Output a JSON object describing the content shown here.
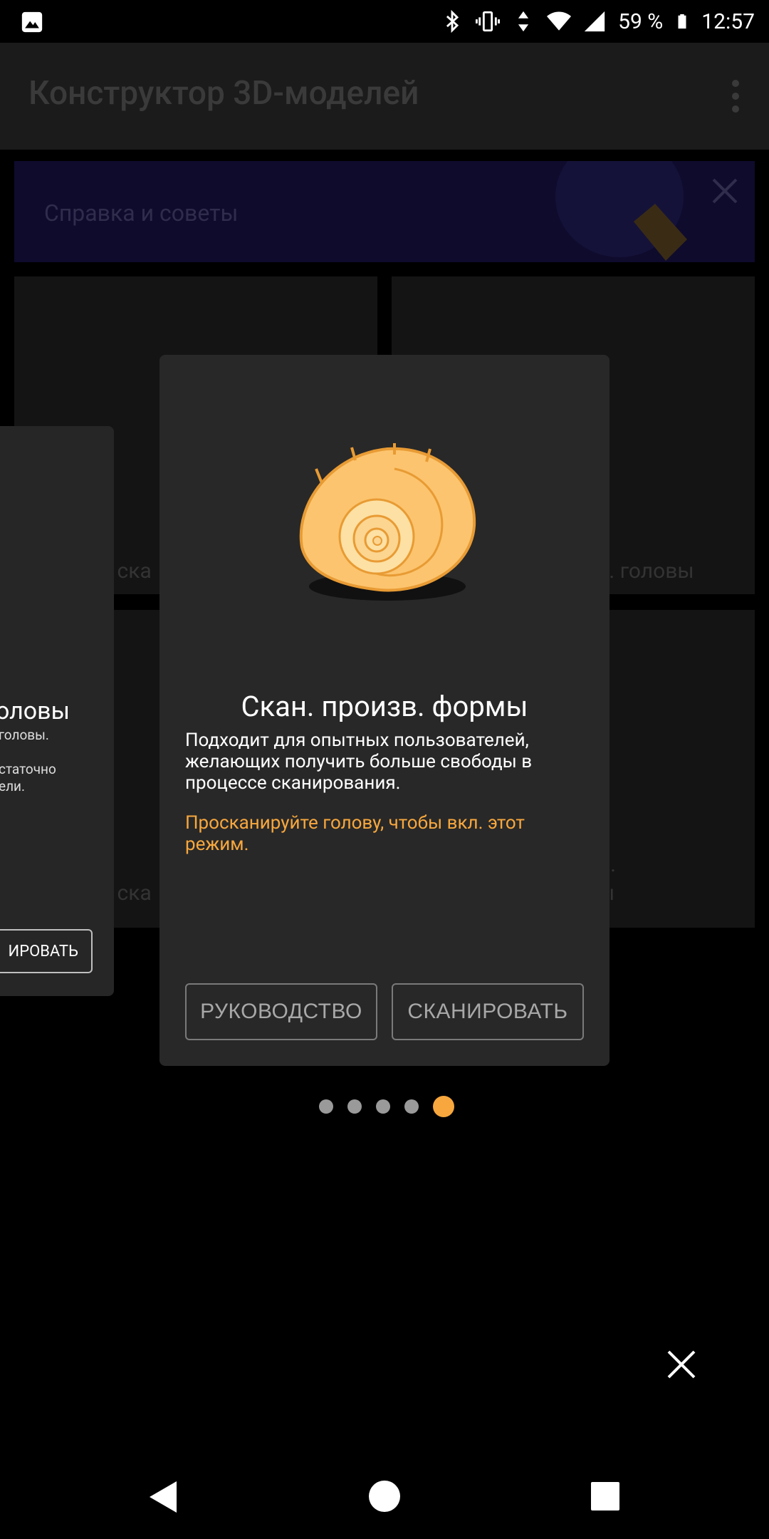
{
  "status": {
    "battery": "59 %",
    "time": "12:57",
    "icons": [
      "image-icon",
      "bluetooth-icon",
      "vibrate-icon",
      "data-arrows-icon",
      "wifi-icon",
      "signal-icon",
      "battery-icon"
    ]
  },
  "app": {
    "title": "Конструктор 3D-моделей",
    "help_banner": "Справка и советы"
  },
  "background_cards": {
    "c1": "о ска",
    "c2": "з. головы",
    "c3": "о ска",
    "c4": "в.",
    "c5": "ы"
  },
  "side_card": {
    "title": "оловы",
    "line1": "головы.",
    "line2": "статочно",
    "line3": "ели.",
    "button": "ИРОВАТЬ"
  },
  "dialog": {
    "title": "Скан. произв. формы",
    "description": "Подходит для опытных пользователей, желающих получить больше свободы в процессе сканирования.",
    "warning": "Просканируйте голову, чтобы вкл. этот режим.",
    "guide_button": "РУКОВОДСТВО",
    "scan_button": "СКАНИРОВАТЬ"
  },
  "pager": {
    "count": 5,
    "active": 5
  },
  "colors": {
    "accent": "#f7a73d",
    "dialog_bg": "#282828",
    "background": "#000000"
  }
}
